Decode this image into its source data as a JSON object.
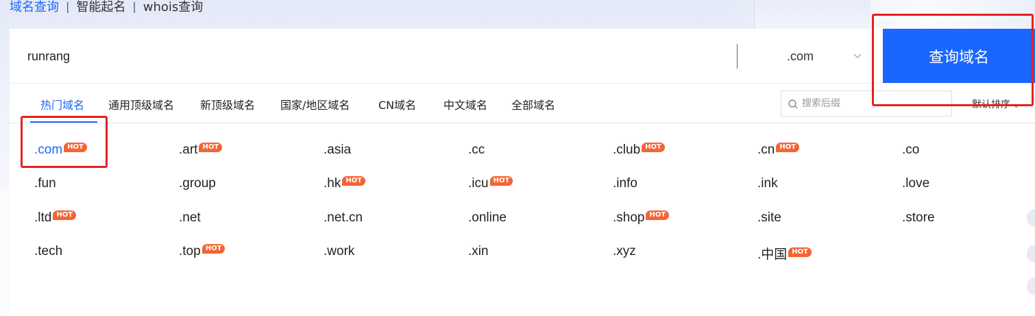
{
  "top_tabs": [
    {
      "label": "域名查询",
      "active": true
    },
    {
      "label": "智能起名",
      "active": false
    },
    {
      "label": "whois查询",
      "active": false
    }
  ],
  "top_separator": "|",
  "search": {
    "value": "runrang",
    "tld_selected": ".com",
    "query_button": "查询域名"
  },
  "categories": [
    {
      "label": "热门域名",
      "active": true
    },
    {
      "label": "通用顶级域名",
      "active": false
    },
    {
      "label": "新顶级域名",
      "active": false
    },
    {
      "label": "国家/地区域名",
      "active": false
    },
    {
      "label": "CN域名",
      "active": false
    },
    {
      "label": "中文域名",
      "active": false
    },
    {
      "label": "全部域名",
      "active": false
    }
  ],
  "suffix_search": {
    "placeholder": "搜索后缀"
  },
  "sort": {
    "label": "默认排序"
  },
  "hot_label": "HOT",
  "tlds": [
    {
      "name": ".com",
      "hot": true,
      "selected": true
    },
    {
      "name": ".art",
      "hot": true
    },
    {
      "name": ".asia",
      "hot": false
    },
    {
      "name": ".cc",
      "hot": false
    },
    {
      "name": ".club",
      "hot": true
    },
    {
      "name": ".cn",
      "hot": true
    },
    {
      "name": ".co",
      "hot": false
    },
    {
      "name": ".fun",
      "hot": false
    },
    {
      "name": ".group",
      "hot": false
    },
    {
      "name": ".hk",
      "hot": true
    },
    {
      "name": ".icu",
      "hot": true
    },
    {
      "name": ".info",
      "hot": false
    },
    {
      "name": ".ink",
      "hot": false
    },
    {
      "name": ".love",
      "hot": false
    },
    {
      "name": ".ltd",
      "hot": true
    },
    {
      "name": ".net",
      "hot": false
    },
    {
      "name": ".net.cn",
      "hot": false
    },
    {
      "name": ".online",
      "hot": false
    },
    {
      "name": ".shop",
      "hot": true
    },
    {
      "name": ".site",
      "hot": false
    },
    {
      "name": ".store",
      "hot": false
    },
    {
      "name": ".tech",
      "hot": false
    },
    {
      "name": ".top",
      "hot": true
    },
    {
      "name": ".work",
      "hot": false
    },
    {
      "name": ".xin",
      "hot": false
    },
    {
      "name": ".xyz",
      "hot": false
    },
    {
      "name": ".中国",
      "hot": true
    }
  ],
  "colors": {
    "accent": "#1a66ff",
    "hot_badge": "#f56434",
    "annotation": "#e52020"
  }
}
